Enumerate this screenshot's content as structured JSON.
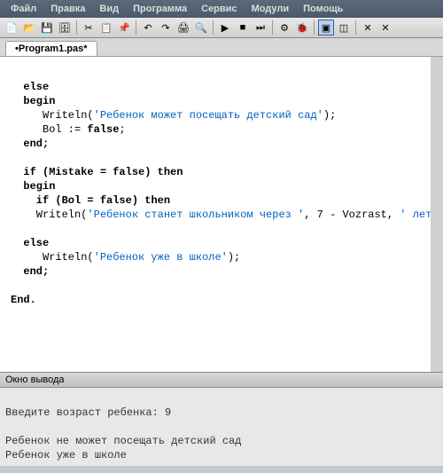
{
  "menu": {
    "items": [
      "Файл",
      "Правка",
      "Вид",
      "Программа",
      "Сервис",
      "Модули",
      "Помощь"
    ]
  },
  "toolbar": {
    "icons": [
      "new-file",
      "open-file",
      "save-file",
      "save-all",
      "cut",
      "copy",
      "paste",
      "undo",
      "redo",
      "print",
      "find",
      "run",
      "stop",
      "step",
      "compile",
      "debug",
      "window",
      "minimize",
      "close1",
      "close2"
    ]
  },
  "tab": {
    "label": "•Program1.pas*"
  },
  "code": {
    "l1": "  else",
    "l2": "  begin",
    "l3a": "     Writeln(",
    "l3b": "'Ребенок может посещать детский сад'",
    "l3c": ");",
    "l4a": "     Bol := ",
    "l4b": "false",
    "l4c": ";",
    "l5": "  end;",
    "l6": "",
    "l7a": "  if (Mistake = ",
    "l7b": "false",
    "l7c": ") then",
    "l8": "  begin",
    "l9a": "    if (Bol = ",
    "l9b": "false",
    "l9c": ") then",
    "l10a": "    Writeln(",
    "l10b": "'Ребенок станет школьником через '",
    "l10c": ", 7 - Vozrast, ",
    "l10d": "' лет'",
    "l10e": ")",
    "l11": "",
    "l12": "  else",
    "l13a": "     Writeln(",
    "l13b": "'Ребенок уже в школе'",
    "l13c": ");",
    "l14": "  end;",
    "l15": "",
    "l16": "End."
  },
  "output": {
    "title": "Окно вывода",
    "l1": "Введите возраст ребенка: 9",
    "l2": "",
    "l3": "Ребенок не может посещать детский сад",
    "l4": "Ребенок уже в школе"
  }
}
